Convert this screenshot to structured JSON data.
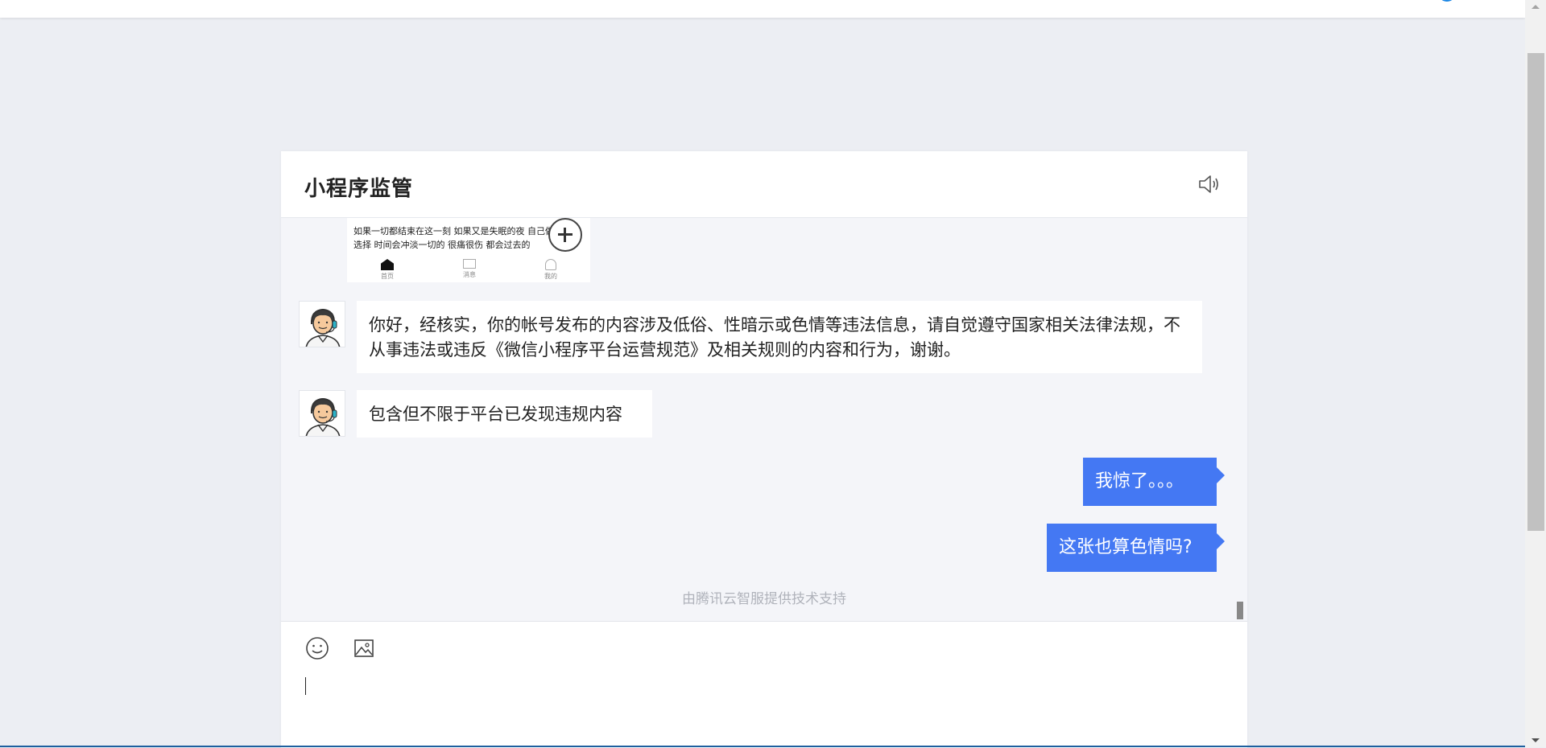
{
  "panel": {
    "title": "小程序监管"
  },
  "preview_image": {
    "line1": "如果一切都结束在这一刻 如果又是失眠的夜 自己做的",
    "line2": "选择 时间会冲淡一切的 很痛很伤 都会过去的",
    "tabs": [
      "首页",
      "消息",
      "我的"
    ]
  },
  "messages": [
    {
      "from": "agent",
      "text": "你好，经核实，你的帐号发布的内容涉及低俗、性暗示或色情等违法信息，请自觉遵守国家相关法律法规，不从事违法或违反《微信小程序平台运营规范》及相关规则的内容和行为，谢谢。"
    },
    {
      "from": "agent",
      "text": "包含但不限于平台已发现违规内容"
    },
    {
      "from": "user",
      "text": "我惊了。。。"
    },
    {
      "from": "user",
      "text": "这张也算色情吗?"
    }
  ],
  "footer": {
    "support": "由腾讯云智服提供技术支持"
  },
  "input": {
    "value": "",
    "toolbar": [
      "emoji-icon",
      "image-icon"
    ]
  },
  "colors": {
    "accent": "#4478f3",
    "background": "#eceef3",
    "chat_bg": "#f4f5f9"
  }
}
